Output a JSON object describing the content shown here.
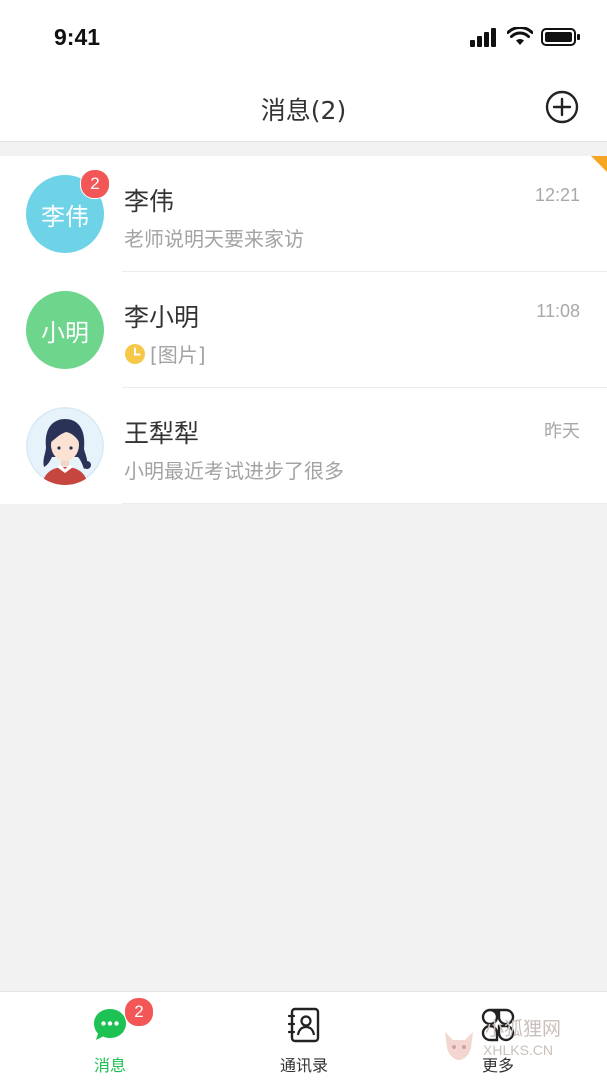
{
  "status_bar": {
    "time": "9:41"
  },
  "header": {
    "title": "消息(2)"
  },
  "conversations": [
    {
      "name": "李伟",
      "avatar_text": "李伟",
      "avatar_color": "#6fd3e8",
      "unread": "2",
      "preview": "老师说明天要来家访",
      "time": "12:21",
      "pinned": true
    },
    {
      "name": "李小明",
      "avatar_text": "小明",
      "avatar_color": "#6dd58c",
      "preview": "[图片]",
      "preview_icon": "clock-icon",
      "time": "11:08"
    },
    {
      "name": "王犁犁",
      "avatar_icon": "girl-avatar-icon",
      "preview": "小明最近考试进步了很多",
      "time": "昨天"
    }
  ],
  "tabs": [
    {
      "label": "消息",
      "icon": "chat-bubble-icon",
      "active": true,
      "badge": "2"
    },
    {
      "label": "通讯录",
      "icon": "contacts-book-icon",
      "active": false
    },
    {
      "label": "更多",
      "icon": "apps-grid-icon",
      "active": false
    }
  ],
  "colors": {
    "accent": "#1ec153",
    "badge": "#f25656",
    "pin_flag": "#f5a623"
  },
  "watermark": {
    "line1": "小狐狸网",
    "line2": "XHLKS.CN"
  }
}
